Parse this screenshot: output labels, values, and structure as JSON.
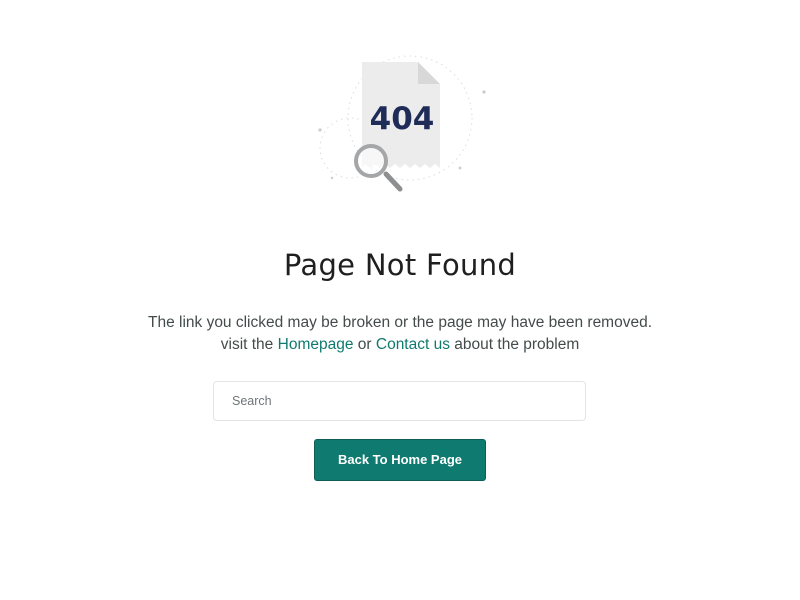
{
  "illustration": {
    "code": "404",
    "icon": "magnifier-icon"
  },
  "title": "Page Not Found",
  "message": {
    "line1": "The link you clicked may be broken or the page may have been removed.",
    "line2_prefix": "visit the",
    "homepage_link": "Homepage",
    "or_text": "or",
    "contact_link": "Contact us",
    "line2_suffix": "about the problem"
  },
  "search": {
    "placeholder": "Search",
    "value": ""
  },
  "button": {
    "label": "Back To Home Page"
  },
  "colors": {
    "accent": "#0f7a6f",
    "link": "#117a70",
    "title": "#1f1f1f",
    "code": "#1e2c57",
    "text": "#444b4b"
  }
}
